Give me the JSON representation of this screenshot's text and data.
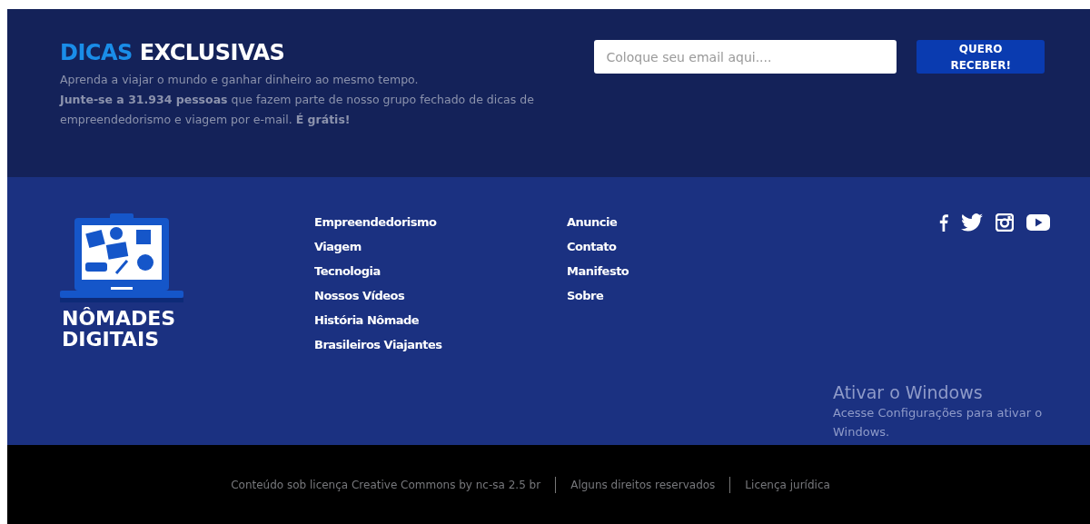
{
  "newsletter": {
    "title_accent": "DICAS",
    "title_rest": "EXCLUSIVAS",
    "intro": "Aprenda a viajar o mundo e ganhar dinheiro ao mesmo tempo.",
    "pitch": "**Junte-se a 31.934 pessoas** que fazem parte de nosso grupo fechado de dicas de empreendedorismo e viagem por e-mail. **É grátis!**",
    "email_placeholder": "Coloque seu email aqui....",
    "submit": "QUERO RECEBER!"
  },
  "brand": {
    "lines": [
      "NÔMADES",
      "DIGITAIS"
    ]
  },
  "menu_columns": [
    [
      "Empreendedorismo",
      "Viagem",
      "Tecnologia",
      "Nossos Vídeos",
      "História Nômade",
      "Brasileiros Viajantes"
    ],
    [
      "Anuncie",
      "Contato",
      "Manifesto",
      "Sobre"
    ]
  ],
  "social": [
    {
      "kind": "facebook"
    },
    {
      "kind": "twitter"
    },
    {
      "kind": "instagram"
    },
    {
      "kind": "youtube"
    }
  ],
  "windows_activation": {
    "title": "Ativar o Windows",
    "text": "Acesse Configurações para ativar o Windows."
  },
  "legal_links": [
    "Conteúdo sob licença Creative Commons by nc-sa 2.5 br",
    "Alguns direitos reservados",
    "Licença jurídica"
  ]
}
